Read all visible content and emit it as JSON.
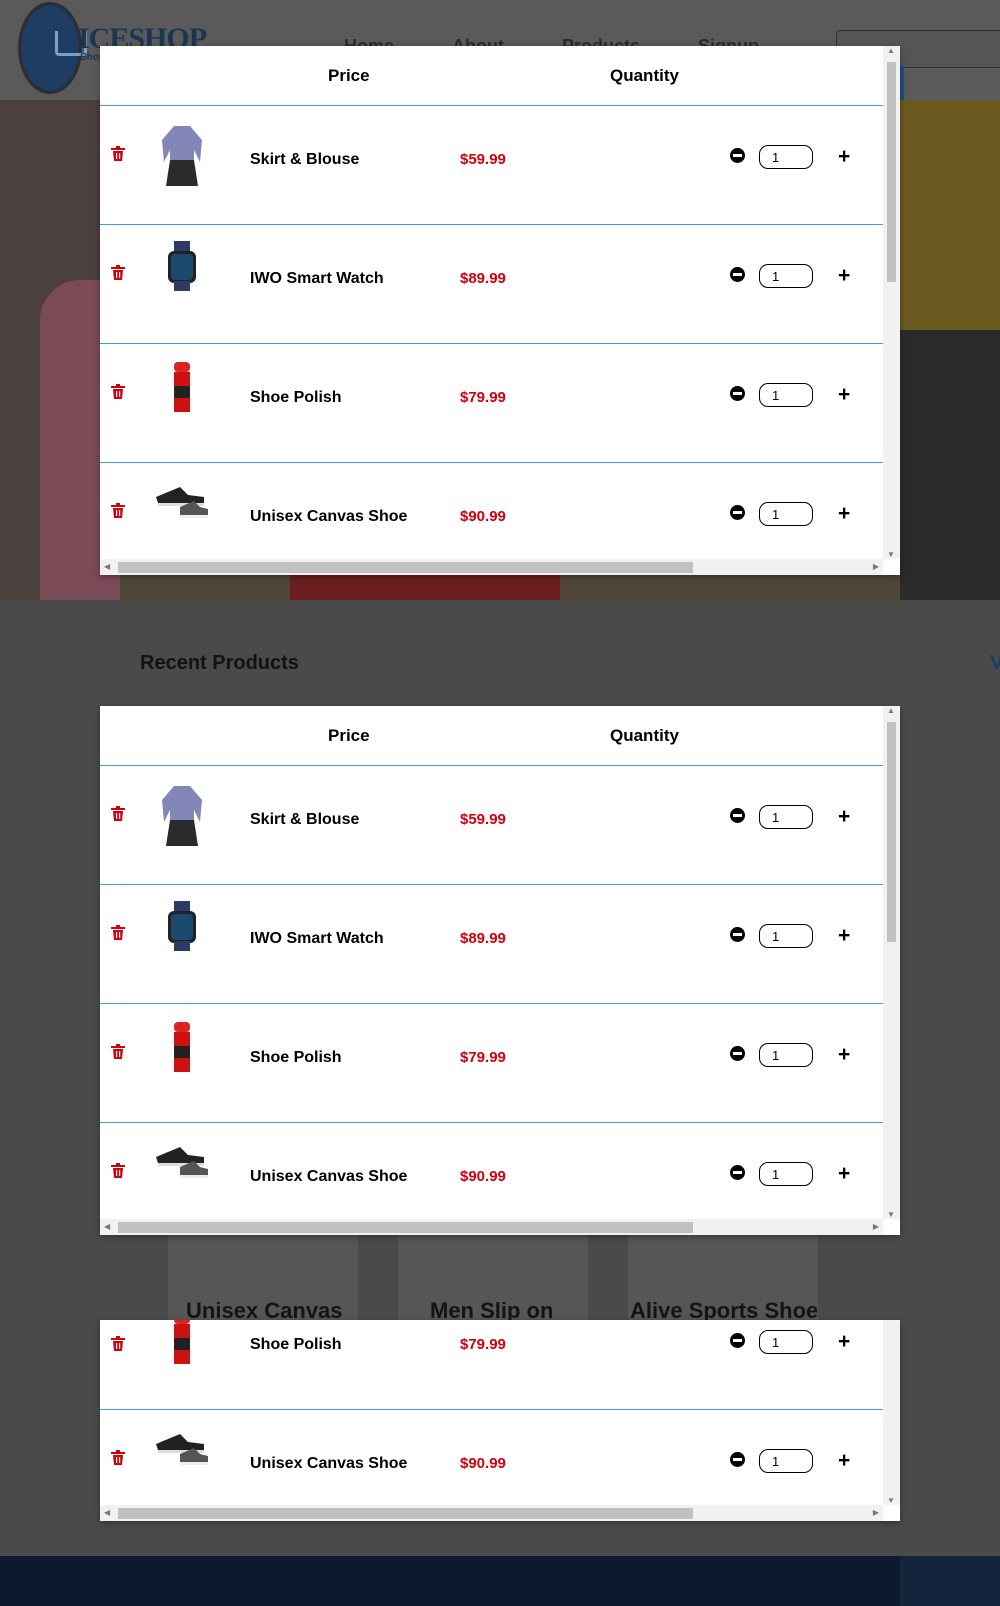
{
  "site": {
    "logo_text": "ICESHOP",
    "logo_sub": "Shop",
    "nav": [
      "Home",
      "About",
      "Products",
      "Signup"
    ]
  },
  "recent": {
    "title": "Recent Products",
    "view_all": "V"
  },
  "bg_products": [
    "Unisex Canvas",
    "Men Slip on",
    "Alive Sports Shoe"
  ],
  "cart": {
    "headers": {
      "price": "Price",
      "quantity": "Quantity"
    },
    "items": [
      {
        "name": "Skirt & Blouse",
        "price": "$59.99",
        "qty": "1",
        "image": "skirt-blouse-image"
      },
      {
        "name": "IWO Smart Watch",
        "price": "$89.99",
        "qty": "1",
        "image": "smart-watch-image"
      },
      {
        "name": "Shoe Polish",
        "price": "$79.99",
        "qty": "1",
        "image": "shoe-polish-image"
      },
      {
        "name": "Unisex Canvas Shoe",
        "price": "$90.99",
        "qty": "1",
        "image": "canvas-shoe-image"
      }
    ]
  },
  "colors": {
    "price": "#d0000d",
    "divider": "#3ba2dc",
    "trash": "#d0000d",
    "footer": "#0c1a2e"
  }
}
